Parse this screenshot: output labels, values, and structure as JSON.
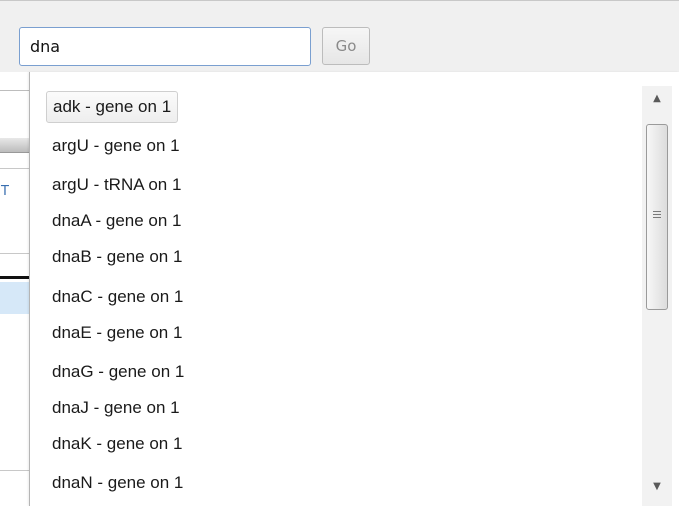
{
  "search": {
    "value": "dna",
    "go_label": "Go"
  },
  "background": {
    "fragment_letter": "T"
  },
  "suggestions": {
    "selected_index": 0,
    "items": [
      {
        "label": "adk - gene on 1"
      },
      {
        "label": "argU - gene on 1"
      },
      {
        "label": "argU - tRNA on 1"
      },
      {
        "label": "dnaA - gene on 1"
      },
      {
        "label": "dnaB - gene on 1"
      },
      {
        "label": "dnaC - gene on 1"
      },
      {
        "label": "dnaE - gene on 1"
      },
      {
        "label": "dnaG - gene on 1"
      },
      {
        "label": "dnaJ - gene on 1"
      },
      {
        "label": "dnaK - gene on 1"
      },
      {
        "label": "dnaN - gene on 1"
      }
    ]
  },
  "scrollbar": {
    "up_icon": "▲",
    "down_icon": "▼"
  },
  "colors": {
    "input_border": "#7a9fd0",
    "selection_bg": "#eeeeee"
  }
}
